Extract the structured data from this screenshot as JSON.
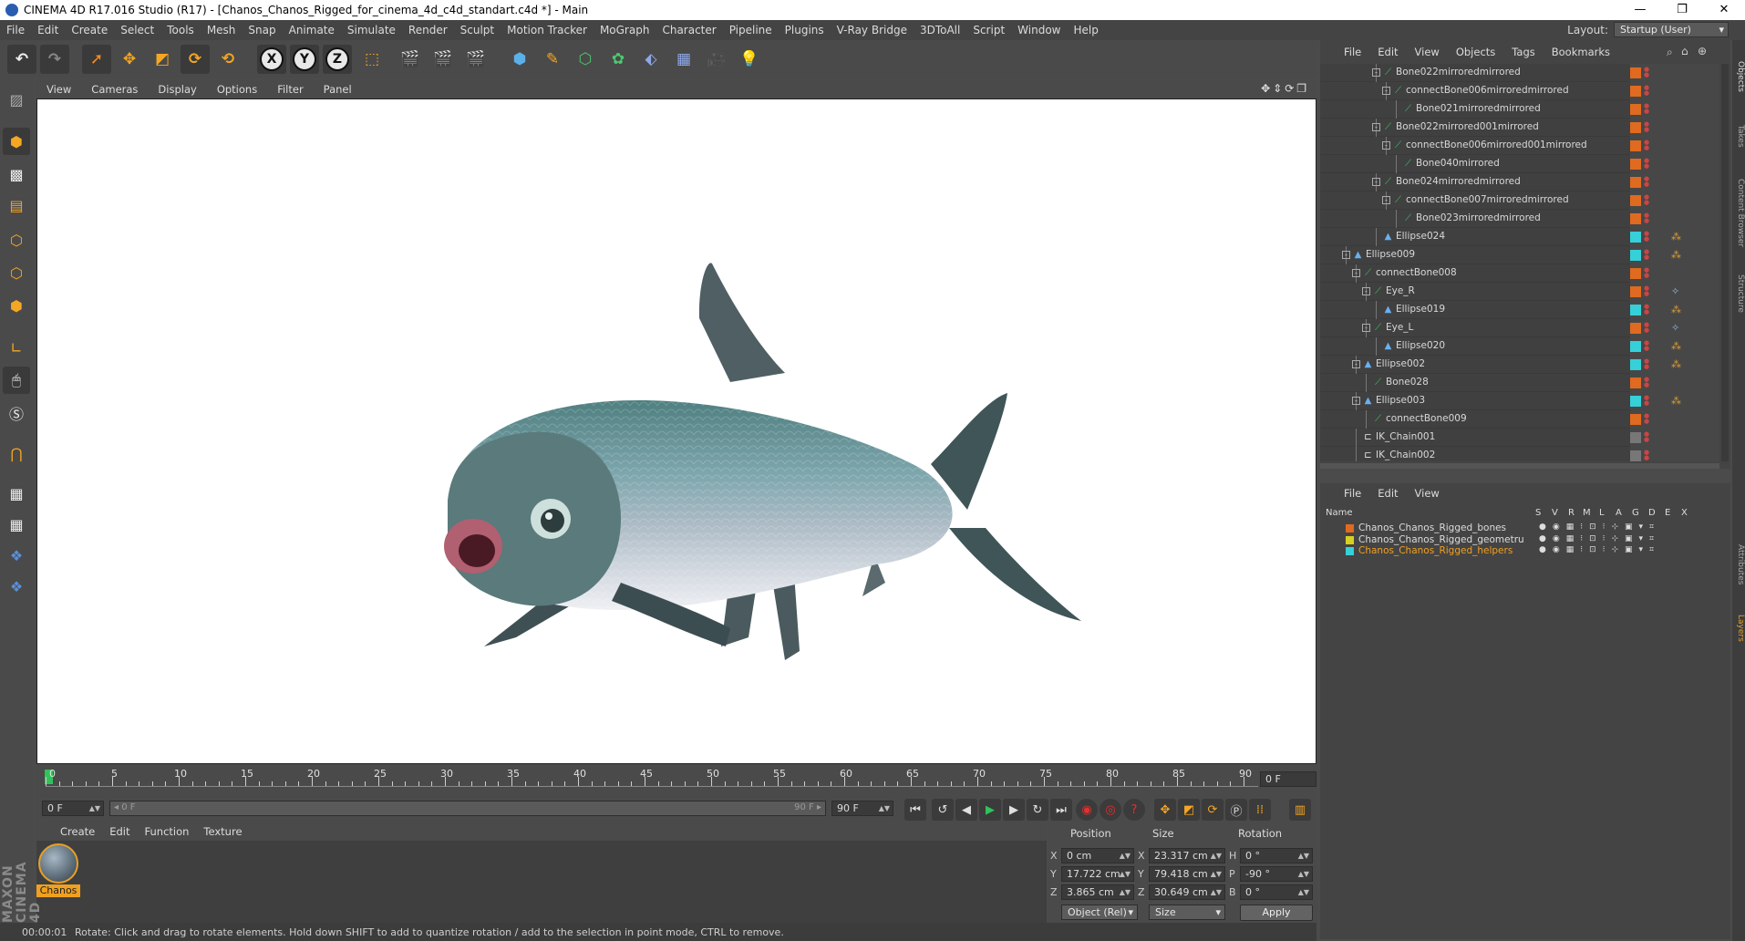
{
  "window": {
    "title": "CINEMA 4D R17.016 Studio (R17) - [Chanos_Chanos_Rigged_for_cinema_4d_c4d_standart.c4d *] - Main",
    "controls": [
      "—",
      "❐",
      "✕"
    ]
  },
  "menubar": {
    "items": [
      "File",
      "Edit",
      "Create",
      "Select",
      "Tools",
      "Mesh",
      "Snap",
      "Animate",
      "Simulate",
      "Render",
      "Sculpt",
      "Motion Tracker",
      "MoGraph",
      "Character",
      "Pipeline",
      "Plugins",
      "V-Ray Bridge",
      "3DToAll",
      "Script",
      "Window",
      "Help"
    ],
    "layout_label": "Layout:",
    "layout_value": "Startup (User)"
  },
  "toolbar": {
    "axis_x": "X",
    "axis_y": "Y",
    "axis_z": "Z"
  },
  "viewport": {
    "menu": [
      "View",
      "Cameras",
      "Display",
      "Options",
      "Filter",
      "Panel"
    ],
    "nav_icons": "✥⇕⟳❐"
  },
  "timeline": {
    "ticks": [
      "0",
      "5",
      "10",
      "15",
      "20",
      "25",
      "30",
      "35",
      "40",
      "45",
      "50",
      "55",
      "60",
      "65",
      "70",
      "75",
      "80",
      "85",
      "90"
    ],
    "current_frame": "0 F"
  },
  "playback": {
    "start_field": "0 F",
    "range_start": "0 F",
    "range_end": "90 F",
    "end_field": "90 F"
  },
  "material_manager": {
    "menu": [
      "Create",
      "Edit",
      "Function",
      "Texture"
    ],
    "material_name": "Chanos"
  },
  "coordinates": {
    "headers": [
      "Position",
      "Size",
      "Rotation"
    ],
    "rows": [
      {
        "axis": "X",
        "pos": "0 cm",
        "size_axis": "X",
        "size": "23.317 cm",
        "rot_axis": "H",
        "rot": "0 °"
      },
      {
        "axis": "Y",
        "pos": "17.722 cm",
        "size_axis": "Y",
        "size": "79.418 cm",
        "rot_axis": "P",
        "rot": "-90 °"
      },
      {
        "axis": "Z",
        "pos": "3.865 cm",
        "size_axis": "Z",
        "size": "30.649 cm",
        "rot_axis": "B",
        "rot": "0 °"
      }
    ],
    "mode": "Object (Rel)",
    "size_mode": "Size",
    "apply": "Apply"
  },
  "statusbar": {
    "time": "00:00:01",
    "message": "Rotate: Click and drag to rotate elements. Hold down SHIFT to add to quantize rotation / add to the selection in point mode, CTRL to remove."
  },
  "branding": {
    "logo_text": "MAXON CINEMA 4D"
  },
  "object_manager": {
    "menu": [
      "File",
      "Edit",
      "View",
      "Objects",
      "Tags",
      "Bookmarks"
    ],
    "rows": [
      {
        "name": "Bone022mirroredmirrored",
        "type": "bone",
        "indent": 5,
        "exp": "-",
        "layer": "#e06a20",
        "tag": ""
      },
      {
        "name": "connectBone006mirroredmirrored",
        "type": "bone",
        "indent": 6,
        "exp": "-",
        "layer": "#e06a20",
        "tag": ""
      },
      {
        "name": "Bone021mirroredmirrored",
        "type": "bone",
        "indent": 7,
        "exp": "",
        "layer": "#e06a20",
        "tag": ""
      },
      {
        "name": "Bone022mirrored001mirrored",
        "type": "bone",
        "indent": 5,
        "exp": "-",
        "layer": "#e06a20",
        "tag": ""
      },
      {
        "name": "connectBone006mirrored001mirrored",
        "type": "bone",
        "indent": 6,
        "exp": "-",
        "layer": "#e06a20",
        "tag": ""
      },
      {
        "name": "Bone040mirrored",
        "type": "bone",
        "indent": 7,
        "exp": "",
        "layer": "#e06a20",
        "tag": ""
      },
      {
        "name": "Bone024mirroredmirrored",
        "type": "bone",
        "indent": 5,
        "exp": "-",
        "layer": "#e06a20",
        "tag": ""
      },
      {
        "name": "connectBone007mirroredmirrored",
        "type": "bone",
        "indent": 6,
        "exp": "-",
        "layer": "#e06a20",
        "tag": ""
      },
      {
        "name": "Bone023mirroredmirrored",
        "type": "bone",
        "indent": 7,
        "exp": "",
        "layer": "#e06a20",
        "tag": ""
      },
      {
        "name": "Ellipse024",
        "type": "spline",
        "indent": 5,
        "exp": "",
        "layer": "#36d0d8",
        "tag": "●"
      },
      {
        "name": "Ellipse009",
        "type": "spline",
        "indent": 2,
        "exp": "-",
        "layer": "#36d0d8",
        "tag": "●"
      },
      {
        "name": "connectBone008",
        "type": "bone",
        "indent": 3,
        "exp": "-",
        "layer": "#e06a20",
        "tag": ""
      },
      {
        "name": "Eye_R",
        "type": "bone",
        "indent": 4,
        "exp": "-",
        "layer": "#e06a20",
        "tag": "◆"
      },
      {
        "name": "Ellipse019",
        "type": "spline",
        "indent": 5,
        "exp": "",
        "layer": "#36d0d8",
        "tag": "●"
      },
      {
        "name": "Eye_L",
        "type": "bone",
        "indent": 4,
        "exp": "-",
        "layer": "#e06a20",
        "tag": "◆"
      },
      {
        "name": "Ellipse020",
        "type": "spline",
        "indent": 5,
        "exp": "",
        "layer": "#36d0d8",
        "tag": "●"
      },
      {
        "name": "Ellipse002",
        "type": "spline",
        "indent": 3,
        "exp": "-",
        "layer": "#36d0d8",
        "tag": "●"
      },
      {
        "name": "Bone028",
        "type": "bone",
        "indent": 4,
        "exp": "",
        "layer": "#e06a20",
        "tag": ""
      },
      {
        "name": "Ellipse003",
        "type": "spline",
        "indent": 3,
        "exp": "-",
        "layer": "#36d0d8",
        "tag": "●"
      },
      {
        "name": "connectBone009",
        "type": "bone",
        "indent": 4,
        "exp": "",
        "layer": "#e06a20",
        "tag": ""
      },
      {
        "name": "IK_Chain001",
        "type": "ik",
        "indent": 3,
        "exp": "",
        "layer": "#777777",
        "tag": ""
      },
      {
        "name": "IK_Chain002",
        "type": "ik",
        "indent": 3,
        "exp": "",
        "layer": "#777777",
        "tag": ""
      }
    ]
  },
  "layer_manager": {
    "menu": [
      "File",
      "Edit",
      "View"
    ],
    "columns": [
      "Name",
      "S",
      "V",
      "R",
      "M",
      "L",
      "A",
      "G",
      "D",
      "E",
      "X"
    ],
    "layers": [
      {
        "name": "Chanos_Chanos_Rigged_bones",
        "color": "#e06a20",
        "active": false
      },
      {
        "name": "Chanos_Chanos_Rigged_geometru",
        "color": "#d8d020",
        "active": false
      },
      {
        "name": "Chanos_Chanos_Rigged_helpers",
        "color": "#36d0d8",
        "active": true
      }
    ]
  },
  "right_tabs": [
    "Objects",
    "Takes",
    "Content Browser",
    "Structure",
    "Attributes",
    "Layers"
  ]
}
